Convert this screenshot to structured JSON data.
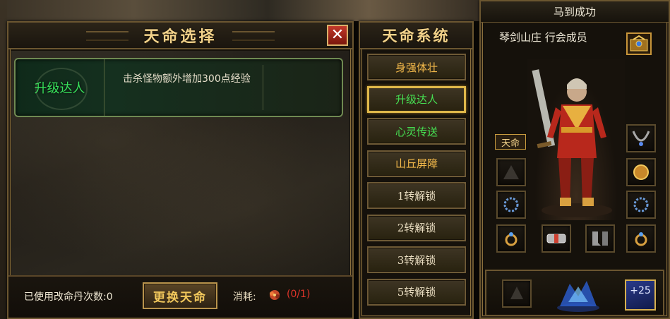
{
  "fate_panel": {
    "title": "天命选择",
    "close_label": "✕",
    "card": {
      "name": "升级达人",
      "description": "击杀怪物额外增加300点经验"
    },
    "footer": {
      "used_count": "已使用改命丹次数:0",
      "change_button": "更换天命",
      "cost_label": "消耗:",
      "cost_amount": "(0/1)"
    }
  },
  "system_panel": {
    "title": "天命系统",
    "items": [
      {
        "label": "身强体壮"
      },
      {
        "label": "升级达人"
      },
      {
        "label": "心灵传送"
      },
      {
        "label": "山丘屏障"
      },
      {
        "label": "1转解锁"
      },
      {
        "label": "2转解锁"
      },
      {
        "label": "3转解锁"
      },
      {
        "label": "5转解锁"
      }
    ],
    "selected_index": 1
  },
  "character_panel": {
    "character_name": "马到成功",
    "guild": "琴剑山庄 行会成员",
    "fate_tag": "天命",
    "level_bonus": "+25"
  },
  "colors": {
    "title_gold": "#f2d28a",
    "fate_green": "#37e05a",
    "cost_red": "#e0352a",
    "frame_gold": "#6b5630"
  }
}
